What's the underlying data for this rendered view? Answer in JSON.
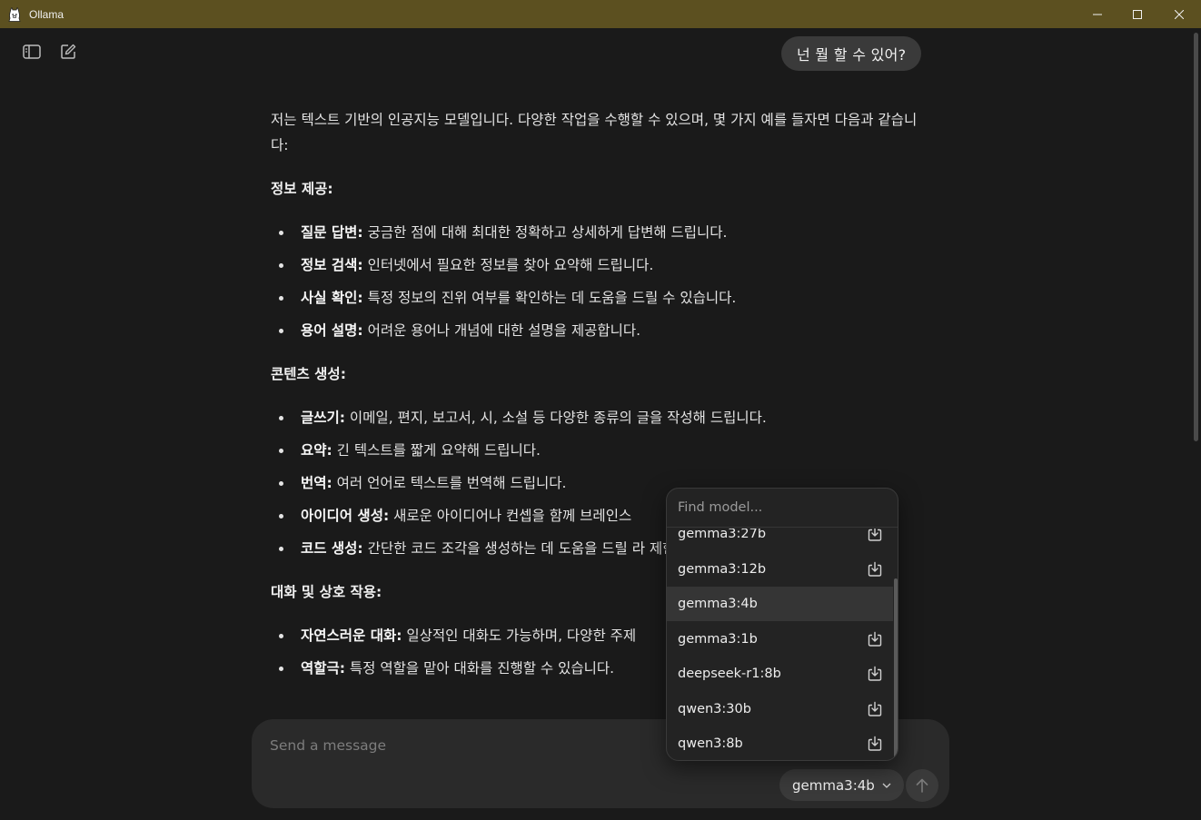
{
  "window": {
    "title": "Ollama"
  },
  "user_message": "넌 뭘 할 수 있어?",
  "response": {
    "intro": "저는 텍스트 기반의 인공지능 모델입니다. 다양한 작업을 수행할 수 있으며, 몇 가지 예를 들자면 다음과 같습니다:",
    "sections": [
      {
        "title": "정보 제공:",
        "items": [
          {
            "term": "질문 답변:",
            "desc": " 궁금한 점에 대해 최대한 정확하고 상세하게 답변해 드립니다."
          },
          {
            "term": "정보 검색:",
            "desc": " 인터넷에서 필요한 정보를 찾아 요약해 드립니다."
          },
          {
            "term": "사실 확인:",
            "desc": " 특정 정보의 진위 여부를 확인하는 데 도움을 드릴 수 있습니다."
          },
          {
            "term": "용어 설명:",
            "desc": " 어려운 용어나 개념에 대한 설명을 제공합니다."
          }
        ]
      },
      {
        "title": "콘텐츠 생성:",
        "items": [
          {
            "term": "글쓰기:",
            "desc": " 이메일, 편지, 보고서, 시, 소설 등 다양한 종류의 글을 작성해 드립니다."
          },
          {
            "term": "요약:",
            "desc": " 긴 텍스트를 짧게 요약해 드립니다."
          },
          {
            "term": "번역:",
            "desc": " 여러 언어로 텍스트를 번역해 드립니다."
          },
          {
            "term": "아이디어 생성:",
            "desc": " 새로운 아이디어나 컨셉을 함께 브레인스"
          },
          {
            "term": "코드 생성:",
            "desc": " 간단한 코드 조각을 생성하는 데 도움을 드릴 라 제한될 수 있습니다.)"
          }
        ]
      },
      {
        "title": "대화 및 상호 작용:",
        "items": [
          {
            "term": "자연스러운 대화:",
            "desc": " 일상적인 대화도 가능하며, 다양한 주제"
          },
          {
            "term": "역할극:",
            "desc": " 특정 역할을 맡아 대화를 진행할 수 있습니다."
          }
        ]
      }
    ]
  },
  "composer": {
    "placeholder": "Send a message",
    "selected_model": "gemma3:4b"
  },
  "model_dropdown": {
    "search_placeholder": "Find model...",
    "models": [
      {
        "name": "gemma3:27b",
        "downloadable": true,
        "selected": false
      },
      {
        "name": "gemma3:12b",
        "downloadable": true,
        "selected": false
      },
      {
        "name": "gemma3:4b",
        "downloadable": false,
        "selected": true
      },
      {
        "name": "gemma3:1b",
        "downloadable": true,
        "selected": false
      },
      {
        "name": "deepseek-r1:8b",
        "downloadable": true,
        "selected": false
      },
      {
        "name": "qwen3:30b",
        "downloadable": true,
        "selected": false
      },
      {
        "name": "qwen3:8b",
        "downloadable": true,
        "selected": false
      }
    ]
  },
  "icons": {
    "sidebar_toggle": "sidebar-icon",
    "new_chat": "compose-icon",
    "download": "download-icon",
    "send": "arrow-up-icon",
    "chevron": "chevron-down-icon"
  },
  "colors": {
    "titlebar": "#5c5020",
    "background": "#1a1a1a",
    "panel": "#2a2a2a"
  }
}
